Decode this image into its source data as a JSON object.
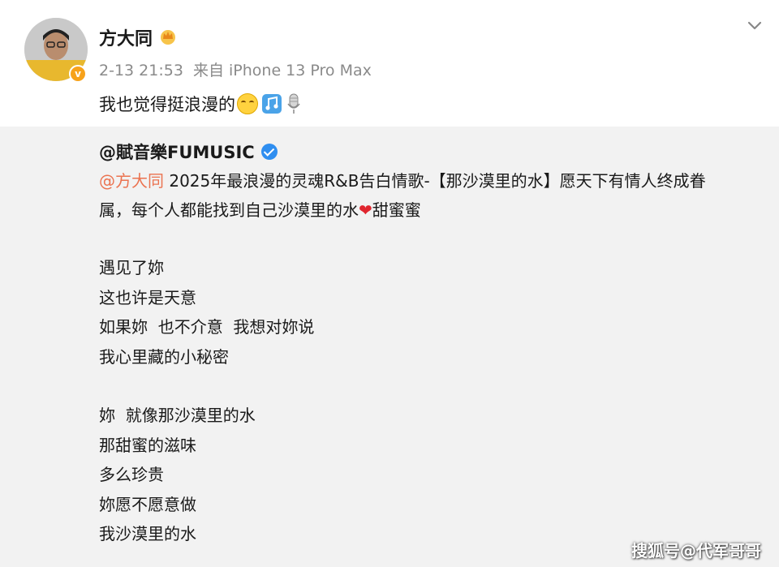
{
  "post": {
    "author": "方大同",
    "author_icon": "crown-icon",
    "date": "2-13 21:53",
    "source": "来自 iPhone 13 Pro Max",
    "text": "我也觉得挺浪漫的",
    "emojis": [
      "smile-emoji",
      "music-note-emoji",
      "microphone-emoji"
    ]
  },
  "repost": {
    "author": "@賦音樂FUMUSIC",
    "mention": "@方大同",
    "body_line1": " 2025年最浪漫的灵魂R&B告白情歌-【那沙漠里的水】愿天下有情人终成眷",
    "body_line2": "属，每个人都能找到自己沙漠里的水",
    "heart": "❤",
    "body_tail": "甜蜜蜜",
    "stanza1": [
      "遇见了妳",
      "这也许是天意",
      "如果妳  也不介意  我想对妳说",
      "我心里藏的小秘密"
    ],
    "stanza2": [
      "妳  就像那沙漠里的水",
      "那甜蜜的滋味",
      "多么珍贵",
      "妳愿不愿意做",
      "我沙漠里的水"
    ]
  },
  "watermark": "搜狐号@代军哥哥",
  "colors": {
    "mention": "#eb7350",
    "verified_blue": "#2f8ef0",
    "verified_orange": "#f7a21b",
    "repost_bg": "#f2f2f2"
  }
}
